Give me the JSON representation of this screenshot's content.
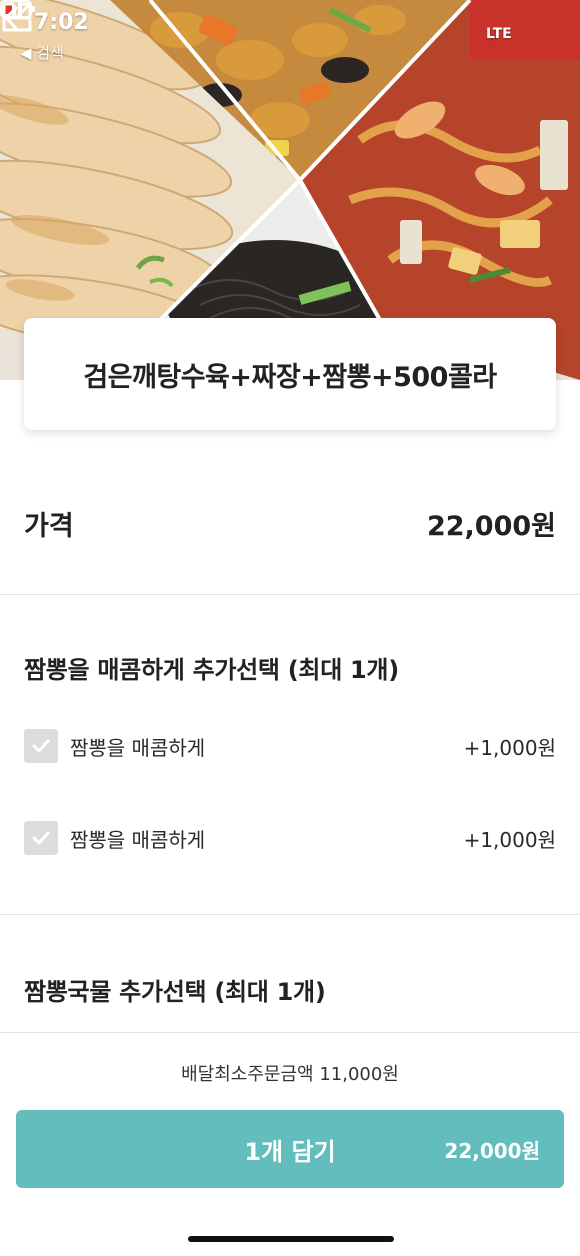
{
  "status_bar": {
    "time": "7:02",
    "back_to_app": "◀ 검색",
    "network": "LTE"
  },
  "icons": {
    "back": "arrow-left-icon",
    "share": "share-icon",
    "location": "location-arrow-icon",
    "signal": "signal-bars-icon",
    "battery": "battery-icon",
    "check": "check-icon"
  },
  "menu": {
    "title": "검은깨탕수육+짜장+짬뽕+500콜라"
  },
  "price": {
    "label": "가격",
    "value": "22,000원"
  },
  "option_group_1": {
    "title": "짬뽕을 매콤하게 추가선택 (최대 1개)",
    "options": [
      {
        "label": "짬뽕을 매콤하게",
        "price": "+1,000원"
      },
      {
        "label": "짬뽕을 매콤하게",
        "price": "+1,000원"
      }
    ]
  },
  "option_group_2": {
    "title": "짬뽕국물 추가선택 (최대 1개)"
  },
  "footer": {
    "min_order": "배달최소주문금액 11,000원",
    "cart_label": "1개 담기",
    "cart_price": "22,000원"
  },
  "colors": {
    "accent": "#63bdbc",
    "checkbox": "#dcdcdc",
    "divider": "#e2e2e2"
  }
}
